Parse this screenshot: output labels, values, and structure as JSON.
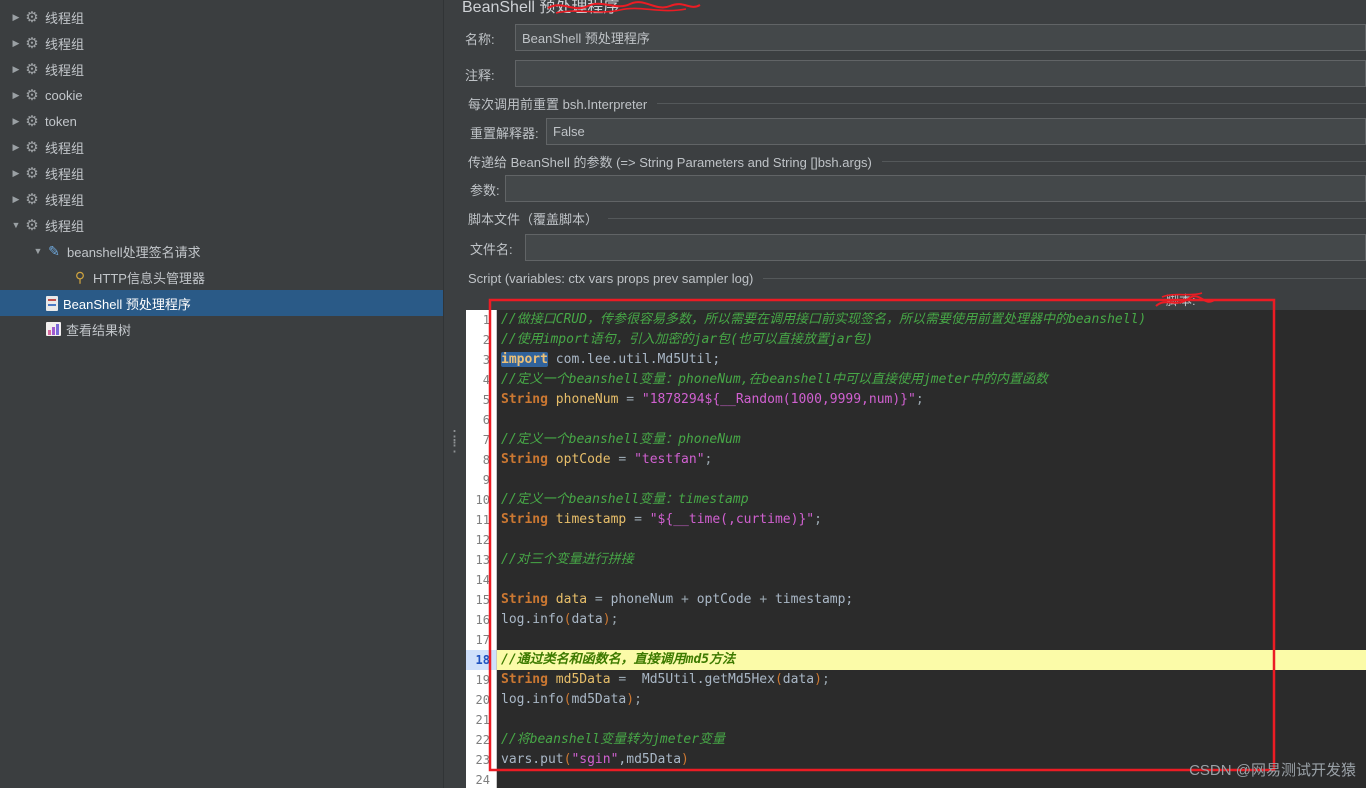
{
  "colors": {
    "annotation_red": "#ec1c24",
    "selection_blue": "#2a5a87",
    "line_highlight_yellow": "#fbfba8",
    "editor_background": "#2b2b2b",
    "panel_background": "#3c3f41"
  },
  "sidebar": {
    "items": [
      {
        "label": "线程组",
        "icon": "gear-icon",
        "level": 0,
        "arrow": "collapsed",
        "selected": false
      },
      {
        "label": "线程组",
        "icon": "gear-icon",
        "level": 0,
        "arrow": "collapsed",
        "selected": false
      },
      {
        "label": "线程组",
        "icon": "gear-icon",
        "level": 0,
        "arrow": "collapsed",
        "selected": false
      },
      {
        "label": "cookie",
        "icon": "gear-icon",
        "level": 0,
        "arrow": "collapsed",
        "selected": false
      },
      {
        "label": "token",
        "icon": "gear-icon",
        "level": 0,
        "arrow": "collapsed",
        "selected": false
      },
      {
        "label": "线程组",
        "icon": "gear-icon",
        "level": 0,
        "arrow": "collapsed",
        "selected": false
      },
      {
        "label": "线程组",
        "icon": "gear-icon",
        "level": 0,
        "arrow": "collapsed",
        "selected": false
      },
      {
        "label": "线程组",
        "icon": "gear-icon",
        "level": 0,
        "arrow": "collapsed",
        "selected": false
      },
      {
        "label": "线程组",
        "icon": "gear-icon",
        "level": 0,
        "arrow": "expanded",
        "selected": false
      },
      {
        "label": "beanshell处理签名请求",
        "icon": "pencil-icon",
        "level": 1,
        "arrow": "expanded",
        "selected": false
      },
      {
        "label": "HTTP信息头管理器",
        "icon": "wrench-icon",
        "level": 2,
        "arrow": "none",
        "selected": false
      },
      {
        "label": "BeanShell 预处理程序",
        "icon": "beanshell-icon",
        "level": 1,
        "arrow": "none",
        "selected": true
      },
      {
        "label": "查看结果树",
        "icon": "chart-icon",
        "level": 1,
        "arrow": "none",
        "selected": false
      }
    ]
  },
  "main": {
    "title": "BeanShell 预处理程序",
    "fields": {
      "name_label": "名称:",
      "name_value": "BeanShell 预处理程序",
      "comment_label": "注释:",
      "comment_value": "",
      "reset_section": "每次调用前重置 bsh.Interpreter",
      "reset_label": "重置解释器:",
      "reset_value": "False",
      "params_section": "传递给 BeanShell 的参数 (=> String Parameters and String []bsh.args)",
      "params_label": "参数:",
      "params_value": "",
      "scriptfile_section": "脚本文件（覆盖脚本）",
      "filename_label": "文件名:",
      "filename_value": "",
      "script_section": "Script (variables: ctx vars props prev sampler log)",
      "script_label": "脚本:"
    }
  },
  "editor": {
    "lines": [
      {
        "n": 1,
        "hl": false,
        "t": [
          [
            "c",
            "//做接口CRUD，传参很容易多数，所以需要在调用接口前实现签名，所以需要使用前置处理器中的beanshell)"
          ]
        ]
      },
      {
        "n": 2,
        "hl": false,
        "t": [
          [
            "c",
            "//使用import语句，引入加密的jar包(也可以直接放置jar包)"
          ]
        ]
      },
      {
        "n": 3,
        "hl": false,
        "t": [
          [
            "ki",
            "import"
          ],
          [
            "p",
            " com.lee.util.Md5Util;"
          ]
        ]
      },
      {
        "n": 4,
        "hl": false,
        "t": [
          [
            "c",
            "//定义一个beanshell变量：phoneNum,在beanshell中可以直接使用jmeter中的内置函数"
          ]
        ]
      },
      {
        "n": 5,
        "hl": false,
        "t": [
          [
            "k",
            "String"
          ],
          [
            "v",
            " phoneNum"
          ],
          [
            "o",
            " = "
          ],
          [
            "s",
            "\"1878294${__Random(1000,9999,num)}\""
          ],
          [
            "o",
            ";"
          ]
        ]
      },
      {
        "n": 6,
        "hl": false,
        "t": []
      },
      {
        "n": 7,
        "hl": false,
        "t": [
          [
            "c",
            "//定义一个beanshell变量：phoneNum"
          ]
        ]
      },
      {
        "n": 8,
        "hl": false,
        "t": [
          [
            "k",
            "String"
          ],
          [
            "v",
            " optCode"
          ],
          [
            "o",
            " = "
          ],
          [
            "s",
            "\"testfan\""
          ],
          [
            "o",
            ";"
          ]
        ]
      },
      {
        "n": 9,
        "hl": false,
        "t": []
      },
      {
        "n": 10,
        "hl": false,
        "t": [
          [
            "c",
            "//定义一个beanshell变量：timestamp"
          ]
        ]
      },
      {
        "n": 11,
        "hl": false,
        "t": [
          [
            "k",
            "String"
          ],
          [
            "v",
            " timestamp"
          ],
          [
            "o",
            " = "
          ],
          [
            "s",
            "\"${__time(,curtime)}\""
          ],
          [
            "o",
            ";"
          ]
        ]
      },
      {
        "n": 12,
        "hl": false,
        "t": []
      },
      {
        "n": 13,
        "hl": false,
        "t": [
          [
            "c",
            "//对三个变量进行拼接"
          ]
        ]
      },
      {
        "n": 14,
        "hl": false,
        "t": []
      },
      {
        "n": 15,
        "hl": false,
        "t": [
          [
            "k",
            "String"
          ],
          [
            "v",
            " data"
          ],
          [
            "o",
            " = "
          ],
          [
            "p",
            "phoneNum"
          ],
          [
            "o",
            " + "
          ],
          [
            "p",
            "optCode"
          ],
          [
            "o",
            " + "
          ],
          [
            "p",
            "timestamp;"
          ]
        ]
      },
      {
        "n": 16,
        "hl": false,
        "t": [
          [
            "p",
            "log.info"
          ],
          [
            "b",
            "("
          ],
          [
            "p",
            "data"
          ],
          [
            "b",
            ")"
          ],
          [
            "o",
            ";"
          ]
        ]
      },
      {
        "n": 17,
        "hl": false,
        "t": []
      },
      {
        "n": 18,
        "hl": true,
        "t": [
          [
            "h",
            "//通过类名和函数名，直接调用md5方法"
          ]
        ]
      },
      {
        "n": 19,
        "hl": false,
        "t": [
          [
            "k",
            "String"
          ],
          [
            "v",
            " md5Data"
          ],
          [
            "o",
            " = "
          ],
          [
            "p",
            " Md5Util.getMd5Hex"
          ],
          [
            "b",
            "("
          ],
          [
            "p",
            "data"
          ],
          [
            "b",
            ")"
          ],
          [
            "o",
            ";"
          ]
        ]
      },
      {
        "n": 20,
        "hl": false,
        "t": [
          [
            "p",
            "log.info"
          ],
          [
            "b",
            "("
          ],
          [
            "p",
            "md5Data"
          ],
          [
            "b",
            ")"
          ],
          [
            "o",
            ";"
          ]
        ]
      },
      {
        "n": 21,
        "hl": false,
        "t": []
      },
      {
        "n": 22,
        "hl": false,
        "t": [
          [
            "c",
            "//将beanshell变量转为jmeter变量"
          ]
        ]
      },
      {
        "n": 23,
        "hl": false,
        "t": [
          [
            "p",
            "vars.put"
          ],
          [
            "b",
            "("
          ],
          [
            "s",
            "\"sgin\""
          ],
          [
            "p",
            ",md5Data"
          ],
          [
            "b",
            ")"
          ]
        ]
      },
      {
        "n": 24,
        "hl": false,
        "t": []
      }
    ]
  },
  "watermark": "CSDN @网易测试开发猿"
}
